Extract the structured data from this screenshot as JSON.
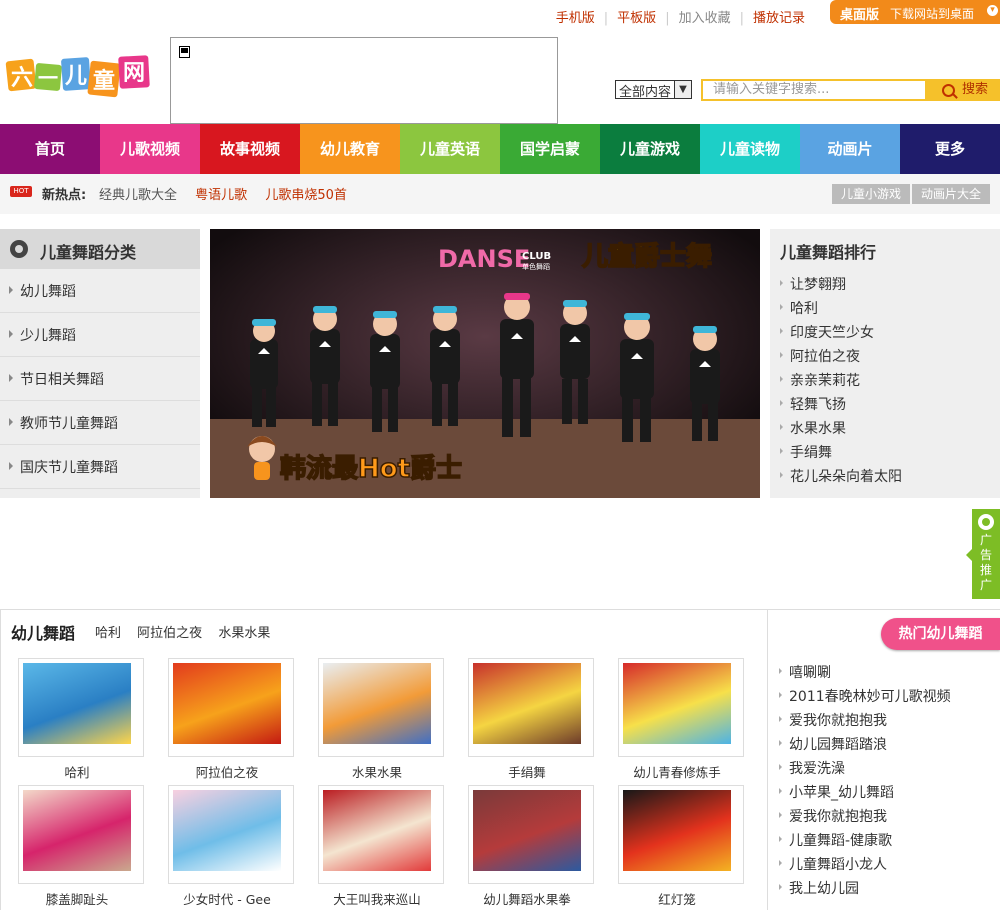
{
  "top_links": {
    "mobile": "手机版",
    "tablet": "平板版",
    "favorite": "加入收藏",
    "history": "播放记录",
    "desktop_title": "桌面版",
    "desktop_download": "下载网站到桌面"
  },
  "logo": {
    "chars": [
      "六",
      "一",
      "儿",
      "童",
      "网"
    ]
  },
  "search": {
    "scope": "全部内容",
    "placeholder": "请输入关键字搜索...",
    "button": "搜索"
  },
  "nav": [
    {
      "label": "首页",
      "color": "#8c0d73"
    },
    {
      "label": "儿歌视频",
      "color": "#e8378a"
    },
    {
      "label": "故事视频",
      "color": "#d8171f"
    },
    {
      "label": "幼儿教育",
      "color": "#f7941d"
    },
    {
      "label": "儿童英语",
      "color": "#8cc63f"
    },
    {
      "label": "国学启蒙",
      "color": "#3aaa35"
    },
    {
      "label": "儿童游戏",
      "color": "#0b7d3e"
    },
    {
      "label": "儿童读物",
      "color": "#1dcfc7"
    },
    {
      "label": "动画片",
      "color": "#5aa3e2"
    },
    {
      "label": "更多",
      "color": "#1f1c6b"
    }
  ],
  "hot": {
    "badge": "HOT",
    "title": "新热点:",
    "links": [
      "经典儿歌大全",
      "粤语儿歌",
      "儿歌串烧50首"
    ],
    "buttons": [
      "儿童小游戏",
      "动画片大全"
    ]
  },
  "category": {
    "title": "儿童舞蹈分类",
    "items": [
      "幼儿舞蹈",
      "少儿舞蹈",
      "节日相关舞蹈",
      "教师节儿童舞蹈",
      "国庆节儿童舞蹈"
    ]
  },
  "banner": {
    "logo_text": "DANSE",
    "logo_sub": "CLUB",
    "logo_cn": "单色舞蹈",
    "title": "儿童爵士舞",
    "caption": "韩流最Hot爵士"
  },
  "ranking": {
    "title": "儿童舞蹈排行",
    "items": [
      "让梦翱翔",
      "哈利",
      "印度天竺少女",
      "阿拉伯之夜",
      "亲亲茉莉花",
      "轻舞飞扬",
      "水果水果",
      "手绢舞",
      "花儿朵朵向着太阳"
    ]
  },
  "side_ad": {
    "label": [
      "广",
      "告",
      "推",
      "广"
    ]
  },
  "section": {
    "title": "幼儿舞蹈",
    "tags": [
      "哈利",
      "阿拉伯之夜",
      "水果水果"
    ],
    "videos": [
      {
        "title": "哈利",
        "colors": [
          "#5bb8e8",
          "#2a7fc4",
          "#ffd54a"
        ]
      },
      {
        "title": "阿拉伯之夜",
        "colors": [
          "#e23b1d",
          "#f7a21b",
          "#c41a12"
        ]
      },
      {
        "title": "水果水果",
        "colors": [
          "#e9eef2",
          "#f29b38",
          "#3f6fc6"
        ]
      },
      {
        "title": "手绢舞",
        "colors": [
          "#c7312b",
          "#f5d542",
          "#6d3b2a"
        ]
      },
      {
        "title": "幼儿青春修炼手",
        "colors": [
          "#d62a2a",
          "#f7e04a",
          "#4db3e6"
        ]
      },
      {
        "title": "膝盖脚趾头",
        "colors": [
          "#f3d9c9",
          "#d6246b",
          "#caa98e"
        ]
      },
      {
        "title": "少女时代 - Gee",
        "colors": [
          "#f8d0e0",
          "#6fbde8",
          "#ffffff"
        ]
      },
      {
        "title": "大王叫我来巡山",
        "colors": [
          "#ba1d22",
          "#f4e5d0",
          "#e23a3a"
        ]
      },
      {
        "title": "幼儿舞蹈水果拳",
        "colors": [
          "#7a3a3a",
          "#b53b3b",
          "#2c5aa0"
        ]
      },
      {
        "title": "红灯笼",
        "colors": [
          "#181818",
          "#e3321d",
          "#f4b323"
        ]
      }
    ]
  },
  "hot_dance": {
    "title": "热门幼儿舞蹈",
    "items": [
      "嘻唰唰",
      "2011春晚林妙可儿歌视频",
      "爱我你就抱抱我",
      "幼儿园舞蹈踏浪",
      "我爱洗澡",
      "小苹果_幼儿舞蹈",
      "爱我你就抱抱我",
      "儿童舞蹈-健康歌",
      "儿童舞蹈小龙人",
      "我上幼儿园"
    ]
  }
}
